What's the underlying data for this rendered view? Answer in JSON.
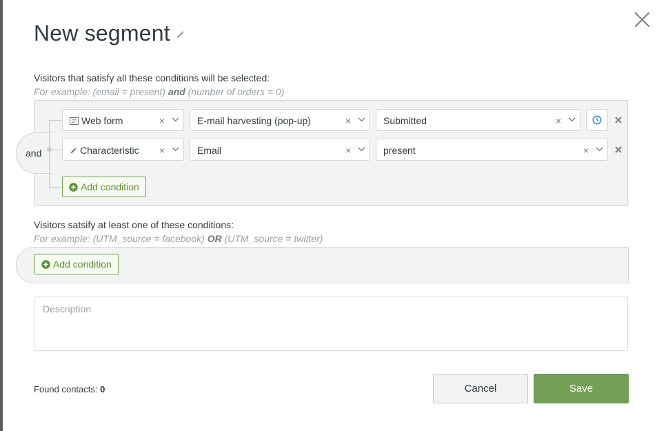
{
  "modal": {
    "title": "New segment",
    "close_icon": "close-icon",
    "edit_icon": "pencil-icon"
  },
  "all_conditions": {
    "label": "Visitors that satisfy all these conditions will be selected:",
    "example_prefix": "For example: (email = present) ",
    "example_operator": "and",
    "example_suffix": " (number of orders = 0)",
    "operator_label": "and",
    "rows": [
      {
        "field_icon": "web-form-icon",
        "field": "Web form",
        "target": "E-mail harvesting (pop-up)",
        "value": "Submitted",
        "has_time_button": true
      },
      {
        "field_icon": "pencil-icon",
        "field": "Characteristic",
        "target": "Email",
        "value": "present",
        "has_time_button": false
      }
    ],
    "add_label": "Add condition"
  },
  "any_conditions": {
    "label": "Visitors satsify at least one of these conditions:",
    "example_prefix": "For example: (UTM_source = facebook) ",
    "example_operator": "OR",
    "example_suffix": " (UTM_source = twitter)",
    "add_label": "Add condition"
  },
  "description": {
    "placeholder": "Description",
    "value": ""
  },
  "footer": {
    "found_label": "Found contacts: ",
    "found_count": "0",
    "cancel_label": "Cancel",
    "save_label": "Save"
  },
  "colors": {
    "accent_green": "#73a055",
    "clock_blue": "#3a8fd6",
    "title_text": "#2f3a42"
  },
  "glyphs": {
    "clear": "×"
  }
}
